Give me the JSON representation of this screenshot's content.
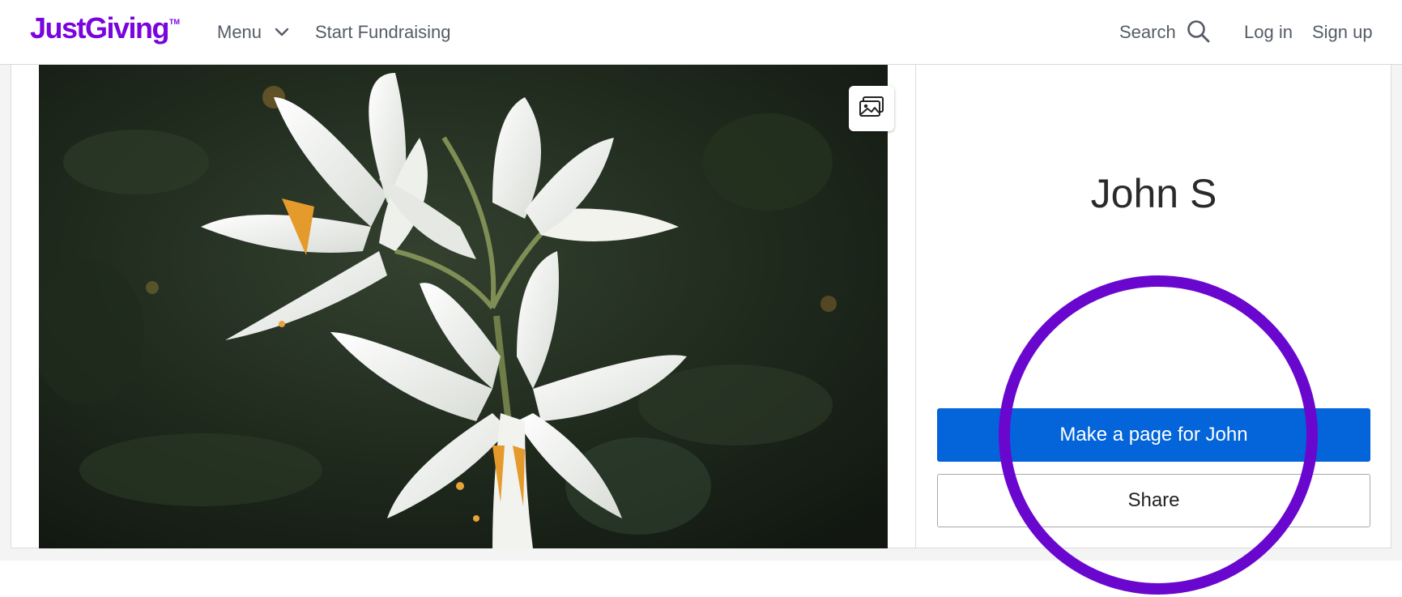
{
  "header": {
    "logo_text": "JustGiving",
    "logo_tm": "TM",
    "menu_label": "Menu",
    "start_label": "Start Fundraising",
    "search_label": "Search",
    "login_label": "Log in",
    "signup_label": "Sign up"
  },
  "hero": {
    "gallery_icon": "image-gallery-icon"
  },
  "profile": {
    "name": "John S",
    "primary_action": "Make a page for John",
    "secondary_action": "Share"
  },
  "colors": {
    "brand": "#7a04dd",
    "primary_button": "#0365d9",
    "highlight_ring": "#6a07cf"
  }
}
